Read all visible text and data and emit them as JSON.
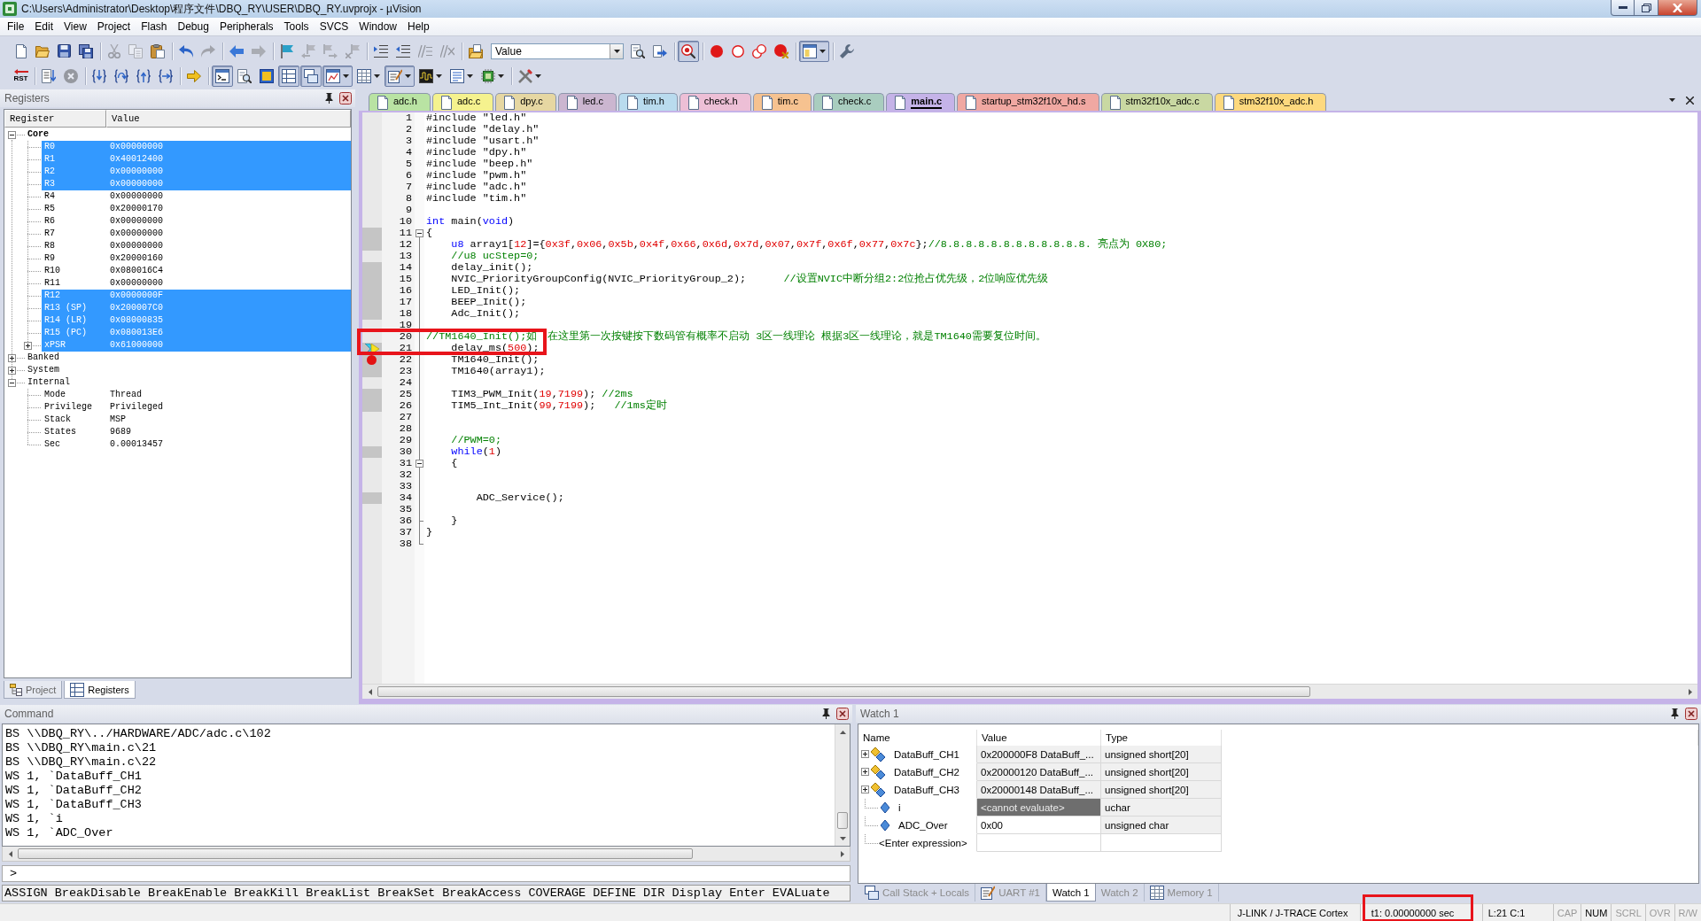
{
  "window": {
    "title": "C:\\Users\\Administrator\\Desktop\\程序文件\\DBQ_RY\\USER\\DBQ_RY.uvprojx - µVision"
  },
  "menu": [
    "File",
    "Edit",
    "View",
    "Project",
    "Flash",
    "Debug",
    "Peripherals",
    "Tools",
    "SVCS",
    "Window",
    "Help"
  ],
  "toolbars": [
    [
      {
        "kind": "new-file",
        "disabled": false,
        "pressed": false,
        "dropdown": false
      },
      {
        "kind": "open-file",
        "disabled": false,
        "pressed": false,
        "dropdown": false
      },
      {
        "kind": "save",
        "disabled": false,
        "pressed": false,
        "dropdown": false
      },
      {
        "kind": "save-all",
        "disabled": false,
        "pressed": false,
        "dropdown": false
      },
      {
        "kind": "separator"
      },
      {
        "kind": "cut",
        "disabled": true,
        "pressed": false,
        "dropdown": false
      },
      {
        "kind": "copy",
        "disabled": true,
        "pressed": false,
        "dropdown": false
      },
      {
        "kind": "paste",
        "disabled": false,
        "pressed": false,
        "dropdown": false
      },
      {
        "kind": "separator"
      },
      {
        "kind": "undo",
        "disabled": false,
        "pressed": false,
        "dropdown": false
      },
      {
        "kind": "redo",
        "disabled": true,
        "pressed": false,
        "dropdown": false
      },
      {
        "kind": "separator"
      },
      {
        "kind": "navigate-back",
        "disabled": false,
        "pressed": false,
        "dropdown": false
      },
      {
        "kind": "navigate-forward",
        "disabled": true,
        "pressed": false,
        "dropdown": false
      },
      {
        "kind": "separator"
      },
      {
        "kind": "bookmark",
        "disabled": false,
        "pressed": false,
        "dropdown": false
      },
      {
        "kind": "bookmark-prev",
        "disabled": true,
        "pressed": false,
        "dropdown": false
      },
      {
        "kind": "bookmark-next",
        "disabled": true,
        "pressed": false,
        "dropdown": false
      },
      {
        "kind": "bookmark-clear",
        "disabled": true,
        "pressed": false,
        "dropdown": false
      },
      {
        "kind": "separator"
      },
      {
        "kind": "indent",
        "disabled": false,
        "pressed": false,
        "dropdown": false
      },
      {
        "kind": "unindent",
        "disabled": false,
        "pressed": false,
        "dropdown": false
      },
      {
        "kind": "comment",
        "disabled": true,
        "pressed": false,
        "dropdown": false
      },
      {
        "kind": "uncomment",
        "disabled": true,
        "pressed": false,
        "dropdown": false
      },
      {
        "kind": "separator"
      },
      {
        "kind": "find-in-files",
        "disabled": false,
        "pressed": false,
        "dropdown": false
      },
      {
        "kind": "combo",
        "value": "Value"
      },
      {
        "kind": "find",
        "disabled": false,
        "pressed": false,
        "dropdown": false
      },
      {
        "kind": "incremental-find",
        "disabled": false,
        "pressed": false,
        "dropdown": false
      },
      {
        "kind": "separator"
      },
      {
        "kind": "debug-session",
        "disabled": false,
        "pressed": true,
        "dropdown": false
      },
      {
        "kind": "separator"
      },
      {
        "kind": "breakpoint-insert",
        "disabled": false,
        "pressed": false,
        "dropdown": false
      },
      {
        "kind": "breakpoint-enable",
        "disabled": false,
        "pressed": false,
        "dropdown": false
      },
      {
        "kind": "breakpoint-disable-all",
        "disabled": false,
        "pressed": false,
        "dropdown": false
      },
      {
        "kind": "breakpoint-kill-all",
        "disabled": false,
        "pressed": false,
        "dropdown": false
      },
      {
        "kind": "separator"
      },
      {
        "kind": "window-layout",
        "disabled": false,
        "pressed": true,
        "dropdown": true
      },
      {
        "kind": "separator"
      },
      {
        "kind": "configure",
        "disabled": false,
        "pressed": false,
        "dropdown": false
      }
    ],
    [
      {
        "kind": "reset",
        "label": "RST",
        "disabled": false,
        "pressed": false,
        "dropdown": false
      },
      {
        "kind": "separator"
      },
      {
        "kind": "run",
        "disabled": false,
        "pressed": false,
        "dropdown": false
      },
      {
        "kind": "stop",
        "disabled": true,
        "pressed": false,
        "dropdown": false
      },
      {
        "kind": "separator"
      },
      {
        "kind": "step-into",
        "disabled": false,
        "pressed": false,
        "dropdown": false
      },
      {
        "kind": "step-over",
        "disabled": false,
        "pressed": false,
        "dropdown": false
      },
      {
        "kind": "step-out",
        "disabled": false,
        "pressed": false,
        "dropdown": false
      },
      {
        "kind": "run-to-cursor",
        "disabled": false,
        "pressed": false,
        "dropdown": false
      },
      {
        "kind": "separator"
      },
      {
        "kind": "show-next-statement",
        "disabled": false,
        "pressed": false,
        "dropdown": false
      },
      {
        "kind": "separator"
      },
      {
        "kind": "command-window",
        "disabled": false,
        "pressed": true,
        "dropdown": false
      },
      {
        "kind": "disassembly-window",
        "disabled": false,
        "pressed": false,
        "dropdown": false
      },
      {
        "kind": "symbols-window",
        "disabled": false,
        "pressed": false,
        "dropdown": false
      },
      {
        "kind": "registers-window",
        "disabled": false,
        "pressed": true,
        "dropdown": false
      },
      {
        "kind": "call-stack-window",
        "disabled": false,
        "pressed": true,
        "dropdown": false
      },
      {
        "kind": "watch-window",
        "disabled": false,
        "pressed": true,
        "dropdown": true
      },
      {
        "kind": "memory-window",
        "disabled": false,
        "pressed": false,
        "dropdown": true
      },
      {
        "kind": "serial-window",
        "disabled": false,
        "pressed": true,
        "dropdown": true
      },
      {
        "kind": "analysis-window",
        "disabled": false,
        "pressed": false,
        "dropdown": true
      },
      {
        "kind": "trace-window",
        "disabled": false,
        "pressed": false,
        "dropdown": true
      },
      {
        "kind": "system-viewer",
        "disabled": false,
        "pressed": false,
        "dropdown": true
      },
      {
        "kind": "separator"
      },
      {
        "kind": "toolbox",
        "disabled": false,
        "pressed": false,
        "dropdown": true
      }
    ]
  ],
  "registers_panel": {
    "title": "Registers",
    "columns": [
      "Register",
      "Value"
    ],
    "tree": [
      {
        "name": "Core",
        "kind": "node",
        "expanded": true,
        "selected": true,
        "children": [
          {
            "name": "R0",
            "value": "0x00000000",
            "kind": "leaf",
            "changed": true
          },
          {
            "name": "R1",
            "value": "0x40012400",
            "kind": "leaf",
            "changed": true
          },
          {
            "name": "R2",
            "value": "0x00000000",
            "kind": "leaf",
            "changed": true
          },
          {
            "name": "R3",
            "value": "0x00000000",
            "kind": "leaf",
            "changed": true
          },
          {
            "name": "R4",
            "value": "0x00000000",
            "kind": "leaf",
            "changed": false
          },
          {
            "name": "R5",
            "value": "0x20000170",
            "kind": "leaf",
            "changed": false
          },
          {
            "name": "R6",
            "value": "0x00000000",
            "kind": "leaf",
            "changed": false
          },
          {
            "name": "R7",
            "value": "0x00000000",
            "kind": "leaf",
            "changed": false
          },
          {
            "name": "R8",
            "value": "0x00000000",
            "kind": "leaf",
            "changed": false
          },
          {
            "name": "R9",
            "value": "0x20000160",
            "kind": "leaf",
            "changed": false
          },
          {
            "name": "R10",
            "value": "0x080016C4",
            "kind": "leaf",
            "changed": false
          },
          {
            "name": "R11",
            "value": "0x00000000",
            "kind": "leaf",
            "changed": false
          },
          {
            "name": "R12",
            "value": "0x0000000F",
            "kind": "leaf",
            "changed": true
          },
          {
            "name": "R13 (SP)",
            "value": "0x200007C0",
            "kind": "leaf",
            "changed": true
          },
          {
            "name": "R14 (LR)",
            "value": "0x08000835",
            "kind": "leaf",
            "changed": true
          },
          {
            "name": "R15 (PC)",
            "value": "0x080013E6",
            "kind": "leaf",
            "changed": true
          },
          {
            "name": "xPSR",
            "value": "0x61000000",
            "kind": "node",
            "expanded": false,
            "changed": true
          }
        ]
      },
      {
        "name": "Banked",
        "kind": "node",
        "expanded": false,
        "selected": false
      },
      {
        "name": "System",
        "kind": "node",
        "expanded": false,
        "selected": false
      },
      {
        "name": "Internal",
        "kind": "node",
        "expanded": true,
        "selected": false,
        "children": [
          {
            "name": "Mode",
            "value": "Thread",
            "kind": "leaf",
            "changed": false
          },
          {
            "name": "Privilege",
            "value": "Privileged",
            "kind": "leaf",
            "changed": false
          },
          {
            "name": "Stack",
            "value": "MSP",
            "kind": "leaf",
            "changed": false
          },
          {
            "name": "States",
            "value": "9689",
            "kind": "leaf",
            "changed": false
          },
          {
            "name": "Sec",
            "value": "0.00013457",
            "kind": "leaf",
            "changed": false
          }
        ]
      }
    ],
    "tabs": [
      {
        "label": "Project",
        "kind": "project",
        "selected": false
      },
      {
        "label": "Registers",
        "kind": "registers",
        "selected": true
      }
    ]
  },
  "editor": {
    "tabs": [
      {
        "label": "adc.h",
        "color": "#b9e3a3",
        "selected": false
      },
      {
        "label": "adc.c",
        "color": "#f5f28e",
        "selected": false
      },
      {
        "label": "dpy.c",
        "color": "#e6d7a2",
        "selected": false
      },
      {
        "label": "led.c",
        "color": "#cbb6d0",
        "selected": false
      },
      {
        "label": "tim.h",
        "color": "#b9dbee",
        "selected": false
      },
      {
        "label": "check.h",
        "color": "#edbfd6",
        "selected": false
      },
      {
        "label": "tim.c",
        "color": "#f6c290",
        "selected": false
      },
      {
        "label": "check.c",
        "color": "#a9cdbf",
        "selected": false
      },
      {
        "label": "main.c",
        "color": "#c5b3e8",
        "selected": true
      },
      {
        "label": "startup_stm32f10x_hd.s",
        "color": "#f0a8a2",
        "selected": false
      },
      {
        "label": "stm32f10x_adc.c",
        "color": "#c9d8a2",
        "selected": false
      },
      {
        "label": "stm32f10x_adc.h",
        "color": "#fdd97e",
        "selected": false
      }
    ],
    "lines": [
      {
        "number": "1",
        "executable": false,
        "segments": [
          {
            "kind": "plain",
            "text": "#include \"led.h\""
          }
        ]
      },
      {
        "number": "2",
        "executable": false,
        "segments": [
          {
            "kind": "plain",
            "text": "#include \"delay.h\""
          }
        ]
      },
      {
        "number": "3",
        "executable": false,
        "segments": [
          {
            "kind": "plain",
            "text": "#include \"usart.h\""
          }
        ]
      },
      {
        "number": "4",
        "executable": false,
        "segments": [
          {
            "kind": "plain",
            "text": "#include \"dpy.h\""
          }
        ]
      },
      {
        "number": "5",
        "executable": false,
        "segments": [
          {
            "kind": "plain",
            "text": "#include \"beep.h\""
          }
        ]
      },
      {
        "number": "6",
        "executable": false,
        "segments": [
          {
            "kind": "plain",
            "text": "#include \"pwm.h\""
          }
        ]
      },
      {
        "number": "7",
        "executable": false,
        "segments": [
          {
            "kind": "plain",
            "text": "#include \"adc.h\""
          }
        ]
      },
      {
        "number": "8",
        "executable": false,
        "segments": [
          {
            "kind": "plain",
            "text": "#include \"tim.h\""
          }
        ]
      },
      {
        "number": "9",
        "executable": false
      },
      {
        "number": "10",
        "executable": false,
        "segments": [
          {
            "kind": "keyword",
            "text": "int"
          },
          {
            "kind": "plain",
            "text": " main("
          },
          {
            "kind": "keyword",
            "text": "void"
          },
          {
            "kind": "plain",
            "text": ")"
          }
        ]
      },
      {
        "number": "11",
        "executable": true,
        "fold_start": true,
        "segments": [
          {
            "kind": "plain",
            "text": "{"
          }
        ]
      },
      {
        "number": "12",
        "executable": true,
        "segments": [
          {
            "kind": "keyword",
            "text": "    u8"
          },
          {
            "kind": "plain",
            "text": " array1["
          },
          {
            "kind": "number",
            "text": "12"
          },
          {
            "kind": "plain",
            "text": "]={"
          },
          {
            "kind": "number",
            "text": "0x3f"
          },
          {
            "kind": "plain",
            "text": ","
          },
          {
            "kind": "number",
            "text": "0x06"
          },
          {
            "kind": "plain",
            "text": ","
          },
          {
            "kind": "number",
            "text": "0x5b"
          },
          {
            "kind": "plain",
            "text": ","
          },
          {
            "kind": "number",
            "text": "0x4f"
          },
          {
            "kind": "plain",
            "text": ","
          },
          {
            "kind": "number",
            "text": "0x66"
          },
          {
            "kind": "plain",
            "text": ","
          },
          {
            "kind": "number",
            "text": "0x6d"
          },
          {
            "kind": "plain",
            "text": ","
          },
          {
            "kind": "number",
            "text": "0x7d"
          },
          {
            "kind": "plain",
            "text": ","
          },
          {
            "kind": "number",
            "text": "0x07"
          },
          {
            "kind": "plain",
            "text": ","
          },
          {
            "kind": "number",
            "text": "0x7f"
          },
          {
            "kind": "plain",
            "text": ","
          },
          {
            "kind": "number",
            "text": "0x6f"
          },
          {
            "kind": "plain",
            "text": ","
          },
          {
            "kind": "number",
            "text": "0x77"
          },
          {
            "kind": "plain",
            "text": ","
          },
          {
            "kind": "number",
            "text": "0x7c"
          },
          {
            "kind": "plain",
            "text": "};"
          },
          {
            "kind": "comment",
            "text": "//8.8.8.8.8.8.8.8.8.8.8.8. 亮点为 0X80;"
          }
        ]
      },
      {
        "number": "13",
        "executable": false,
        "segments": [
          {
            "kind": "comment",
            "text": "    //u8 ucStep=0;"
          }
        ]
      },
      {
        "number": "14",
        "executable": true,
        "segments": [
          {
            "kind": "plain",
            "text": "    delay_init();"
          }
        ]
      },
      {
        "number": "15",
        "executable": true,
        "segments": [
          {
            "kind": "plain",
            "text": "    NVIC_PriorityGroupConfig(NVIC_PriorityGroup_2);      "
          },
          {
            "kind": "comment",
            "text": "//设置NVIC中断分组2:2位抢占优先级，2位响应优先级"
          }
        ]
      },
      {
        "number": "16",
        "executable": true,
        "segments": [
          {
            "kind": "plain",
            "text": "    LED_Init();"
          }
        ]
      },
      {
        "number": "17",
        "executable": true,
        "segments": [
          {
            "kind": "plain",
            "text": "    BEEP_Init();"
          }
        ]
      },
      {
        "number": "18",
        "executable": true,
        "segments": [
          {
            "kind": "plain",
            "text": "    Adc_Init();"
          }
        ]
      },
      {
        "number": "19",
        "executable": false
      },
      {
        "number": "20",
        "executable": false,
        "marked": true,
        "segments": [
          {
            "kind": "comment",
            "text": "//TM1640_Init();如",
            "hidden_after": true
          },
          {
            "kind": "comment",
            "text": "在这里第一次按键按下数码管有概率不启动 3区一线理论 根据3区一线理论，就是TM1640需要复位时间。"
          }
        ]
      },
      {
        "number": "21",
        "executable": true,
        "current": true,
        "marked": true,
        "segments": [
          {
            "kind": "plain",
            "text": "    delay_ms("
          },
          {
            "kind": "number",
            "text": "500"
          },
          {
            "kind": "plain",
            "text": ");"
          }
        ]
      },
      {
        "number": "22",
        "executable": true,
        "breakpoint": true,
        "segments": [
          {
            "kind": "plain",
            "text": "    TM1640_Init();"
          }
        ]
      },
      {
        "number": "23",
        "executable": true,
        "segments": [
          {
            "kind": "plain",
            "text": "    TM1640(array1);"
          }
        ]
      },
      {
        "number": "24",
        "executable": false
      },
      {
        "number": "25",
        "executable": true,
        "segments": [
          {
            "kind": "plain",
            "text": "    TIM3_PWM_Init("
          },
          {
            "kind": "number",
            "text": "19"
          },
          {
            "kind": "plain",
            "text": ","
          },
          {
            "kind": "number",
            "text": "7199"
          },
          {
            "kind": "plain",
            "text": "); "
          },
          {
            "kind": "comment",
            "text": "//2ms"
          }
        ]
      },
      {
        "number": "26",
        "executable": true,
        "segments": [
          {
            "kind": "plain",
            "text": "    TIM5_Int_Init("
          },
          {
            "kind": "number",
            "text": "99"
          },
          {
            "kind": "plain",
            "text": ","
          },
          {
            "kind": "number",
            "text": "7199"
          },
          {
            "kind": "plain",
            "text": ");   "
          },
          {
            "kind": "comment",
            "text": "//1ms定时"
          }
        ]
      },
      {
        "number": "27",
        "executable": false
      },
      {
        "number": "28",
        "executable": false
      },
      {
        "number": "29",
        "executable": false,
        "segments": [
          {
            "kind": "comment",
            "text": "    //PWM=0;"
          }
        ]
      },
      {
        "number": "30",
        "executable": true,
        "segments": [
          {
            "kind": "keyword",
            "text": "    while"
          },
          {
            "kind": "plain",
            "text": "("
          },
          {
            "kind": "number",
            "text": "1"
          },
          {
            "kind": "plain",
            "text": ")"
          }
        ]
      },
      {
        "number": "31",
        "executable": false,
        "fold_start": true,
        "segments": [
          {
            "kind": "plain",
            "text": "    {"
          }
        ]
      },
      {
        "number": "32",
        "executable": false
      },
      {
        "number": "33",
        "executable": false
      },
      {
        "number": "34",
        "executable": true,
        "segments": [
          {
            "kind": "plain",
            "text": "        ADC_Service();"
          }
        ]
      },
      {
        "number": "35",
        "executable": false
      },
      {
        "number": "36",
        "executable": false,
        "fold_end": true,
        "segments": [
          {
            "kind": "plain",
            "text": "    }"
          }
        ]
      },
      {
        "number": "37",
        "executable": false,
        "segments": [
          {
            "kind": "plain",
            "text": "}"
          }
        ]
      },
      {
        "number": "38",
        "executable": false,
        "fold_end": true
      }
    ]
  },
  "command_panel": {
    "title": "Command",
    "output": [
      "BS \\\\DBQ_RY\\../HARDWARE/ADC/adc.c\\102",
      "BS \\\\DBQ_RY\\main.c\\21",
      "BS \\\\DBQ_RY\\main.c\\22",
      "WS 1, `DataBuff_CH1",
      "WS 1, `DataBuff_CH2",
      "WS 1, `DataBuff_CH3",
      "WS 1, `i",
      "WS 1, `ADC_Over"
    ],
    "prompt": ">",
    "hint": "ASSIGN BreakDisable BreakEnable BreakKill BreakList BreakSet BreakAccess COVERAGE DEFINE DIR Display Enter EVALuate"
  },
  "watch_panel": {
    "title": "Watch 1",
    "columns": [
      "Name",
      "Value",
      "Type"
    ],
    "rows": [
      {
        "kind": "array",
        "name": "DataBuff_CH1",
        "value": "0x200000F8 DataBuff_...",
        "type": "unsigned short[20]",
        "expanded": false,
        "editable": false,
        "error": false
      },
      {
        "kind": "array",
        "name": "DataBuff_CH2",
        "value": "0x20000120 DataBuff_...",
        "type": "unsigned short[20]",
        "expanded": false,
        "editable": false,
        "error": false
      },
      {
        "kind": "array",
        "name": "DataBuff_CH3",
        "value": "0x20000148 DataBuff_...",
        "type": "unsigned short[20]",
        "expanded": false,
        "editable": false,
        "error": false
      },
      {
        "kind": "scalar",
        "name": "i",
        "value": "<cannot evaluate>",
        "type": "uchar",
        "editable": false,
        "error": true
      },
      {
        "kind": "scalar",
        "name": "ADC_Over",
        "value": "0x00",
        "type": "unsigned char",
        "editable": true,
        "error": false
      },
      {
        "kind": "entry",
        "name": "<Enter expression>"
      }
    ],
    "tabs": [
      {
        "label": "Call Stack + Locals",
        "kind": "call-stack",
        "selected": false
      },
      {
        "label": "UART #1",
        "kind": "uart",
        "selected": false
      },
      {
        "label": "Watch 1",
        "kind": "watch",
        "selected": true
      },
      {
        "label": "Watch 2",
        "kind": "watch",
        "selected": false
      },
      {
        "label": "Memory 1",
        "kind": "memory",
        "selected": false
      }
    ]
  },
  "status_bar": [
    {
      "kind": "text",
      "text": "J-LINK / J-TRACE Cortex",
      "marked": false
    },
    {
      "kind": "text",
      "text": "t1: 0.00000000 sec",
      "marked": true
    },
    {
      "kind": "text",
      "text": "L:21 C:1",
      "marked": false
    },
    {
      "kind": "indicator",
      "text": "CAP",
      "on": false
    },
    {
      "kind": "indicator",
      "text": "NUM",
      "on": true
    },
    {
      "kind": "indicator",
      "text": "SCRL",
      "on": false
    },
    {
      "kind": "indicator",
      "text": "OVR",
      "on": false
    },
    {
      "kind": "indicator",
      "text": "R/W",
      "on": false
    }
  ]
}
